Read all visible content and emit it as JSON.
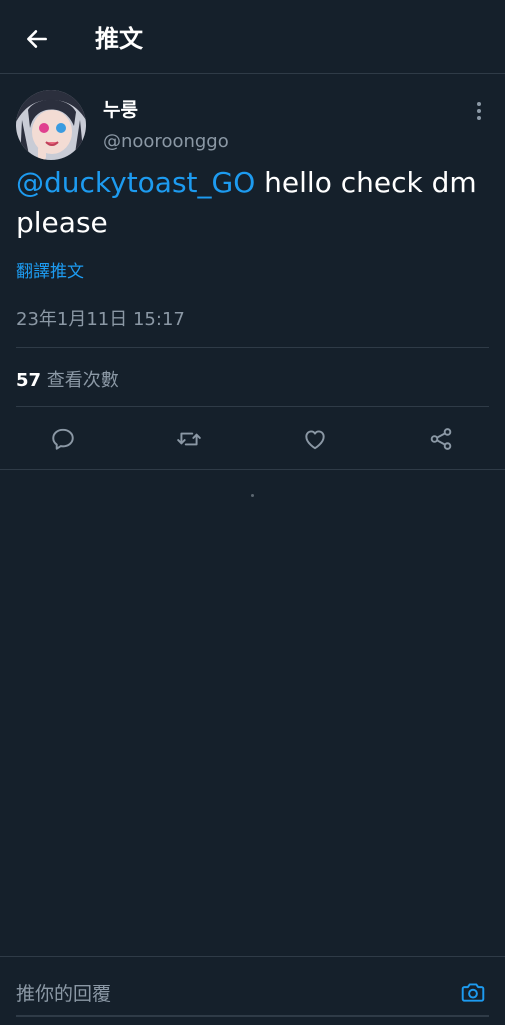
{
  "header": {
    "title": "推文",
    "back_icon": "arrow-left-icon"
  },
  "tweet": {
    "display_name": "누룽",
    "handle": "@nooroonggo",
    "mention": "@duckytoast_GO",
    "text": " hello check dm please",
    "translate_label": "翻譯推文",
    "timestamp": "23年1月11日 15:17",
    "views_count": "57",
    "views_label": " 查看次數"
  },
  "actions": [
    "reply-icon",
    "retweet-icon",
    "like-icon",
    "share-icon"
  ],
  "reply": {
    "placeholder": "推你的回覆",
    "camera_icon": "camera-icon"
  },
  "colors": {
    "background": "#15202b",
    "accent": "#1d9bf0",
    "muted": "#8b98a5",
    "divider": "#2f3b47"
  }
}
